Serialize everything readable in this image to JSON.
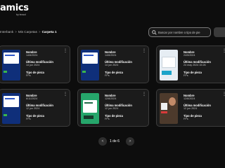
{
  "brand": {
    "logo_text": "amics",
    "logo_subtext": "by tecsol"
  },
  "breadcrumb": {
    "items": [
      "Interbank",
      "Mis Carpetas",
      "Carpeta 1"
    ],
    "separator": ">"
  },
  "search": {
    "placeholder": "Buscar por nombre o tipo de pie",
    "icon": "search-icon"
  },
  "cards": [
    {
      "name_label": "Nombre",
      "name": "14/6/2024",
      "modified_label": "Última modificación",
      "modified": "14 jun 2024",
      "type_label": "Tipo de pieza",
      "type": "FPs",
      "thumb_style": "blue",
      "menu": "⋮"
    },
    {
      "name_label": "Nombre",
      "name": "14/6/2024",
      "modified_label": "Última modificación",
      "modified": "14 jun 2024",
      "type_label": "Tipo de pieza",
      "type": "FPs",
      "thumb_style": "blue",
      "menu": "⋮"
    },
    {
      "name_label": "Nombre",
      "name": "24/5/2024",
      "modified_label": "Última modificación",
      "modified": "24 may 2024 15:26",
      "type_label": "Tipo de pieza",
      "type": "FPs",
      "thumb_style": "pale",
      "menu": "⋮"
    },
    {
      "name_label": "Nombre",
      "name": "6/11/2024",
      "modified_label": "Última modificación",
      "modified": "12 jun 2024",
      "type_label": "Tipo de pieza",
      "type": "FPs",
      "thumb_style": "blue",
      "menu": "⋮"
    },
    {
      "name_label": "Nombre",
      "name": "12/6/2024",
      "modified_label": "Última modificación",
      "modified": "12 jun 2024",
      "type_label": "Tipo de pieza",
      "type": "FPs",
      "thumb_style": "green",
      "menu": "⋮"
    },
    {
      "name_label": "Nombre",
      "name": "12/6/2024",
      "modified_label": "Última modificación",
      "modified": "12 jun 2024",
      "type_label": "Tipo de pieza",
      "type": "FPs",
      "thumb_style": "person",
      "menu": "⋮"
    }
  ],
  "pagination": {
    "prev": "<",
    "text": "1 de 6",
    "next": ">"
  },
  "colors": {
    "background": "#0d0d0d",
    "card": "#1b1b1b",
    "card_border": "#3c3c3c"
  }
}
